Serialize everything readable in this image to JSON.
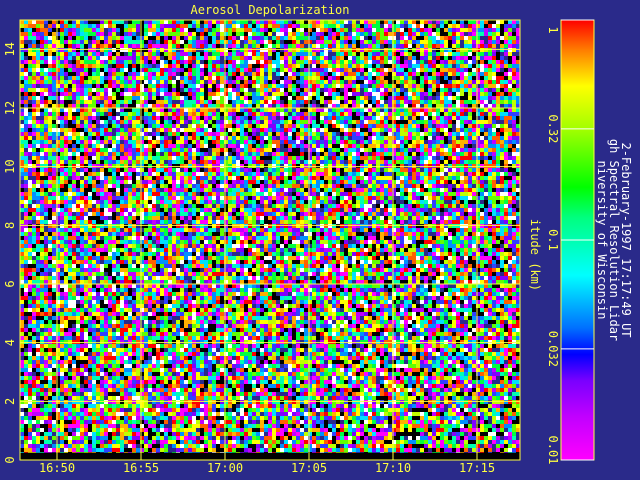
{
  "chart_data": {
    "type": "heatmap",
    "title": "Aerosol Depolarization",
    "ylabel": "itude (km)",
    "x_ticks": [
      "16:50",
      "16:55",
      "17:00",
      "17:05",
      "17:10",
      "17:15"
    ],
    "y_ticks": [
      "0",
      "2",
      "4",
      "6",
      "8",
      "10",
      "12",
      "14"
    ],
    "ylim": [
      0,
      15
    ],
    "colorbar": {
      "scale": "log",
      "range": [
        0.01,
        1
      ],
      "tick_labels": [
        "1",
        "0.32",
        "0.1",
        "0.032",
        "0.01"
      ]
    },
    "grid": true,
    "background_color": "#2a2a8a",
    "grid_color": "#ffff40"
  },
  "side_text": {
    "line1": "niversity of Wisconsin",
    "line2": "gh Spectral Resolution Lidar",
    "line3": "2-February-1997 17:17:49 UT"
  }
}
